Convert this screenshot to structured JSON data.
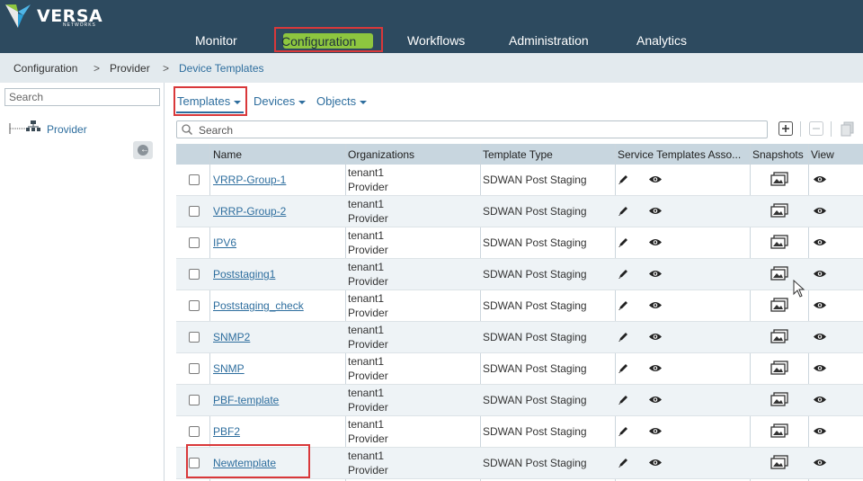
{
  "app": {
    "brand": "VERSA",
    "brand_sub": "NETWORKS"
  },
  "nav": {
    "items": [
      {
        "id": "monitor",
        "label": "Monitor"
      },
      {
        "id": "configuration",
        "label": "Configuration",
        "active": true
      },
      {
        "id": "workflows",
        "label": "Workflows"
      },
      {
        "id": "administration",
        "label": "Administration"
      },
      {
        "id": "analytics",
        "label": "Analytics"
      }
    ]
  },
  "breadcrumb": {
    "items": [
      "Configuration",
      "Provider",
      "Device Templates"
    ],
    "separator": ">"
  },
  "left_panel": {
    "search_placeholder": "Search",
    "tree_root": "Provider"
  },
  "tabs": {
    "items": [
      "Templates",
      "Devices",
      "Objects"
    ],
    "active": "Templates"
  },
  "toolbar": {
    "search_placeholder": "Search",
    "buttons": [
      "add-icon",
      "remove-icon",
      "copy-icon"
    ]
  },
  "table": {
    "columns": [
      "Name",
      "Organizations",
      "Template Type",
      "Service Templates Asso...",
      "Snapshots",
      "View"
    ],
    "rows": [
      {
        "name": "VRRP-Group-1",
        "orgs": [
          "tenant1",
          "Provider"
        ],
        "type": "SDWAN Post Staging"
      },
      {
        "name": "VRRP-Group-2",
        "orgs": [
          "tenant1",
          "Provider"
        ],
        "type": "SDWAN Post Staging"
      },
      {
        "name": "IPV6",
        "orgs": [
          "tenant1",
          "Provider"
        ],
        "type": "SDWAN Post Staging"
      },
      {
        "name": "Poststaging1",
        "orgs": [
          "tenant1",
          "Provider"
        ],
        "type": "SDWAN Post Staging"
      },
      {
        "name": "Poststaging_check",
        "orgs": [
          "tenant1",
          "Provider"
        ],
        "type": "SDWAN Post Staging"
      },
      {
        "name": "SNMP2",
        "orgs": [
          "tenant1",
          "Provider"
        ],
        "type": "SDWAN Post Staging"
      },
      {
        "name": "SNMP",
        "orgs": [
          "tenant1",
          "Provider"
        ],
        "type": "SDWAN Post Staging"
      },
      {
        "name": "PBF-template",
        "orgs": [
          "tenant1",
          "Provider"
        ],
        "type": "SDWAN Post Staging"
      },
      {
        "name": "PBF2",
        "orgs": [
          "tenant1",
          "Provider"
        ],
        "type": "SDWAN Post Staging"
      },
      {
        "name": "Newtemplate",
        "orgs": [
          "tenant1",
          "Provider"
        ],
        "type": "SDWAN Post Staging"
      }
    ]
  },
  "colors": {
    "topbar": "#2d4a5f",
    "accent_green": "#8dc63f",
    "link_blue": "#2e6e9e",
    "highlight_red": "#d9383a"
  }
}
